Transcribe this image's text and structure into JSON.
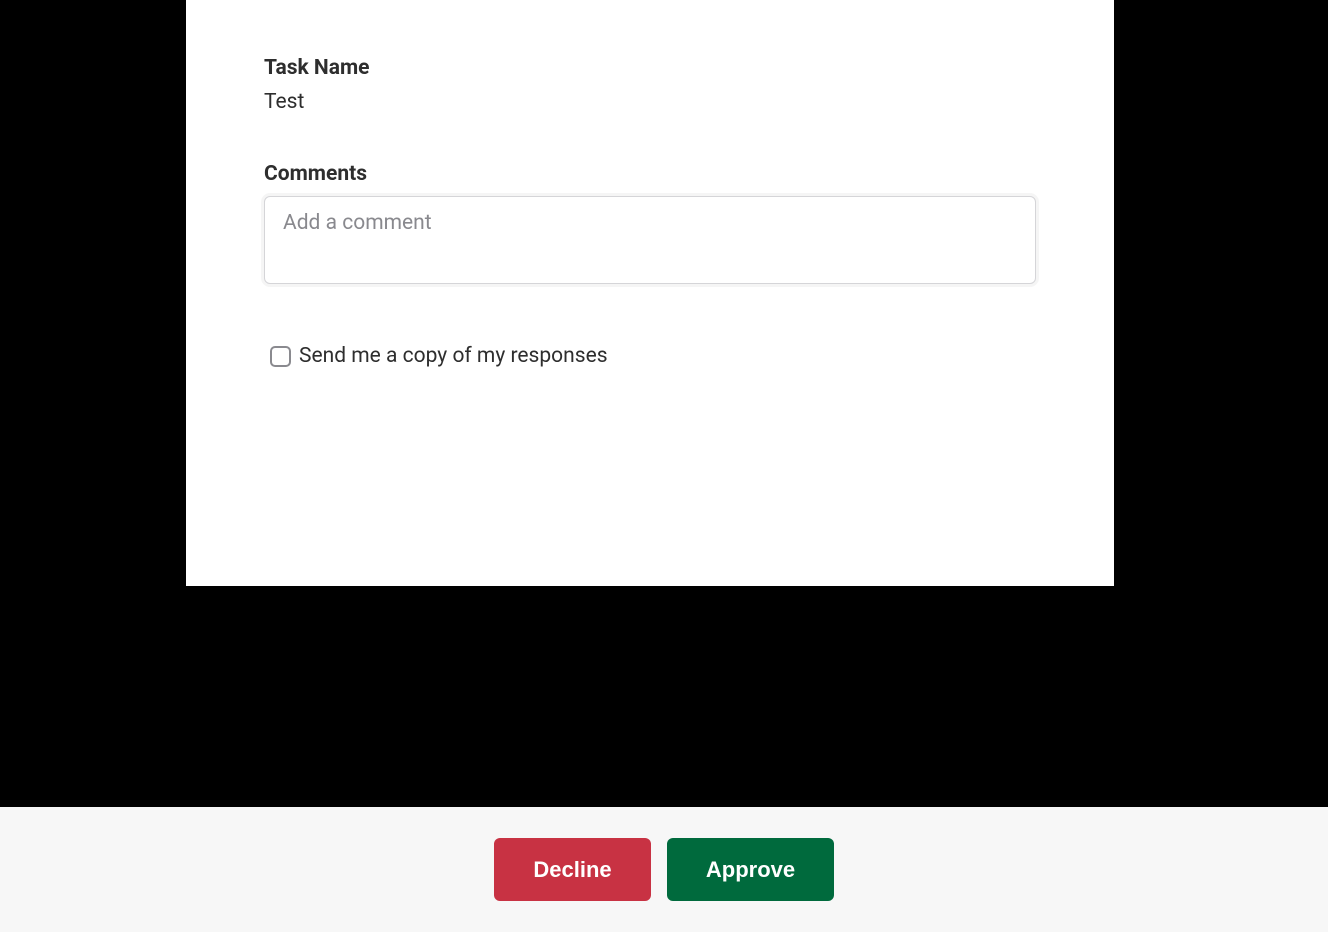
{
  "form": {
    "task_name_label": "Task Name",
    "task_name_value": "Test",
    "comments_label": "Comments",
    "comments_placeholder": "Add a comment",
    "comments_value": "",
    "send_copy_label": "Send me a copy of my responses"
  },
  "actions": {
    "decline_label": "Decline",
    "approve_label": "Approve"
  },
  "colors": {
    "decline": "#c83243",
    "approve": "#006a3d",
    "footer_bg": "#f7f7f7"
  }
}
